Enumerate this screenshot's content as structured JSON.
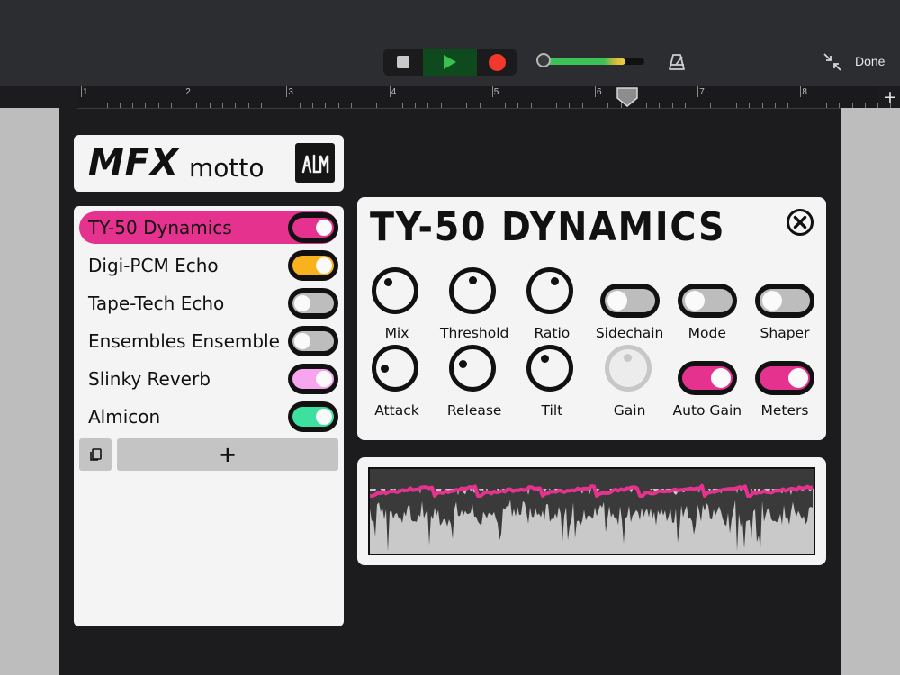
{
  "toolbar": {
    "done_label": "Done",
    "volume_level": 0.82,
    "ruler_marks": [
      "1",
      "2",
      "3",
      "4",
      "5",
      "6",
      "7",
      "8"
    ],
    "ruler_add_label": "+"
  },
  "plugin": {
    "brand": {
      "name": "MFX",
      "subtitle": "motto"
    },
    "effects": [
      {
        "label": "TY-50 Dynamics",
        "selected": true,
        "on": true,
        "color": "#e5328f"
      },
      {
        "label": "Digi-PCM Echo",
        "selected": false,
        "on": true,
        "color": "#f7b21c"
      },
      {
        "label": "Tape-Tech Echo",
        "selected": false,
        "on": false,
        "color": "#bdbdbd"
      },
      {
        "label": "Ensembles Ensemble",
        "selected": false,
        "on": false,
        "color": "#bdbdbd"
      },
      {
        "label": "Slinky Reverb",
        "selected": false,
        "on": true,
        "color": "#f7a5ee"
      },
      {
        "label": "Almicon",
        "selected": false,
        "on": true,
        "color": "#3ee0a0"
      }
    ],
    "add_effect_label": "+",
    "panel": {
      "title": "TY-50 DYNAMICS",
      "controls": [
        {
          "type": "knob",
          "label": "Mix",
          "value": 0.35,
          "enabled": true
        },
        {
          "type": "knob",
          "label": "Threshold",
          "value": 0.5,
          "enabled": true
        },
        {
          "type": "knob",
          "label": "Ratio",
          "value": 0.6,
          "enabled": true
        },
        {
          "type": "toggle",
          "label": "Sidechain",
          "on": false,
          "color": "#bdbdbd"
        },
        {
          "type": "toggle",
          "label": "Mode",
          "on": false,
          "color": "#bdbdbd"
        },
        {
          "type": "toggle",
          "label": "Shaper",
          "on": false,
          "color": "#bdbdbd"
        },
        {
          "type": "knob",
          "label": "Attack",
          "value": 0.15,
          "enabled": true
        },
        {
          "type": "knob",
          "label": "Release",
          "value": 0.25,
          "enabled": true
        },
        {
          "type": "knob",
          "label": "Tilt",
          "value": 0.4,
          "enabled": true
        },
        {
          "type": "knob",
          "label": "Gain",
          "value": 0.5,
          "enabled": false
        },
        {
          "type": "toggle",
          "label": "Auto Gain",
          "on": true,
          "color": "#e5328f"
        },
        {
          "type": "toggle",
          "label": "Meters",
          "on": true,
          "color": "#e5328f"
        }
      ]
    }
  },
  "colors": {
    "accent": "#e5328f",
    "record": "#f2372c",
    "play": "#38c14e"
  }
}
